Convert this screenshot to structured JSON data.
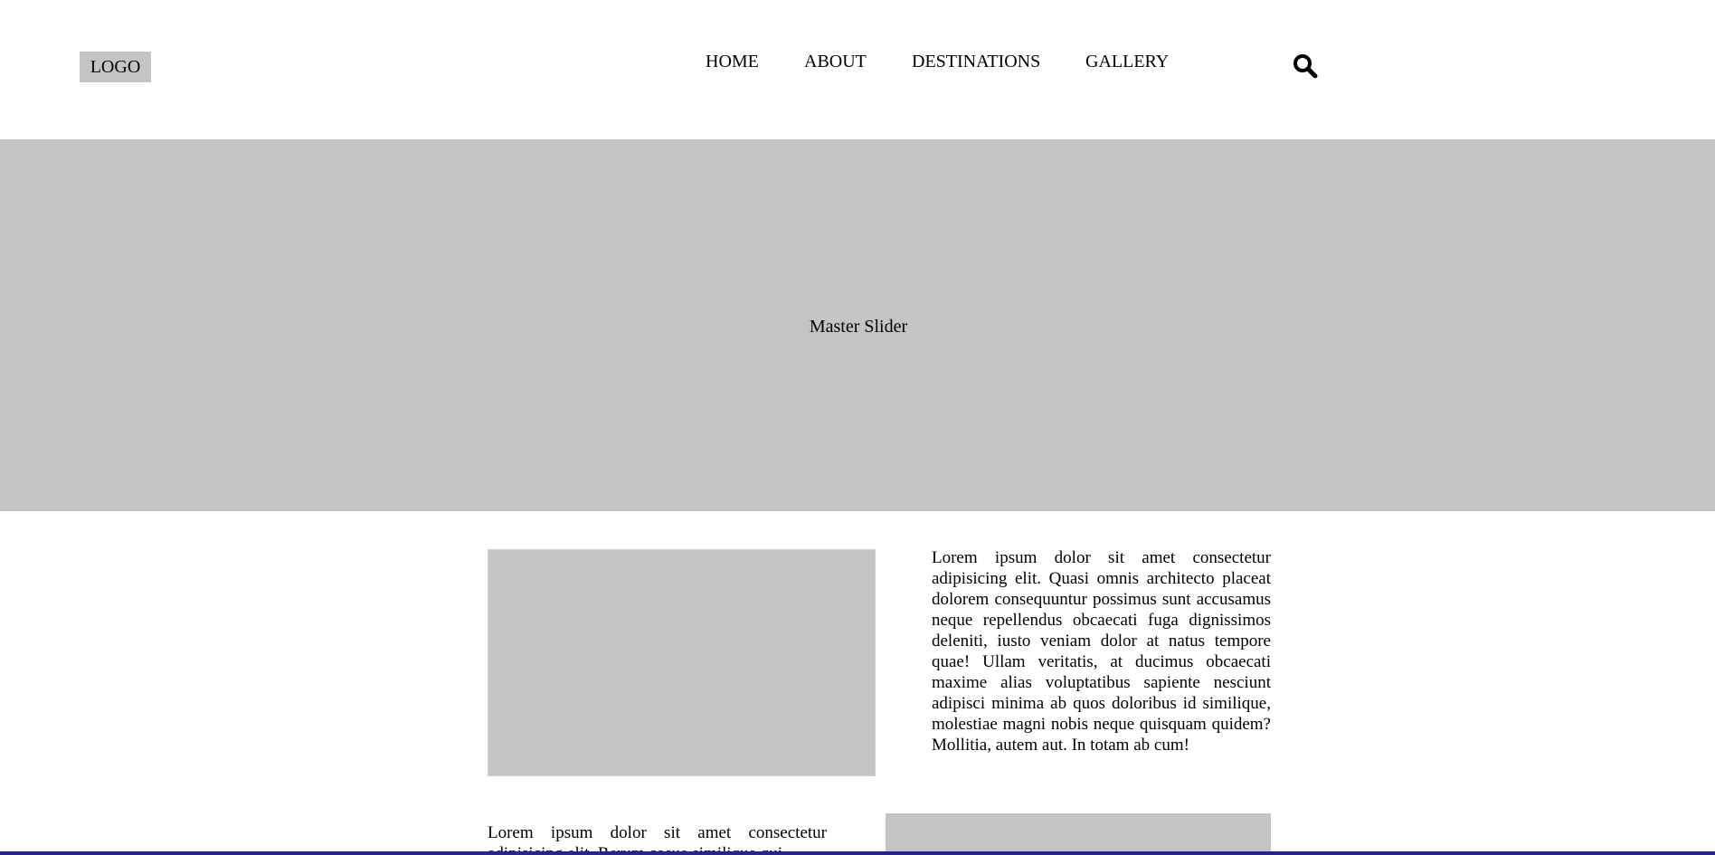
{
  "header": {
    "logo": "LOGO",
    "nav": {
      "home": "HOME",
      "about": "ABOUT",
      "destinations": "DESTINATIONS",
      "gallery": "GALLERY"
    },
    "search_icon": "search-icon"
  },
  "slider": {
    "label": "Master Slider"
  },
  "content": {
    "paragraph_1": "Lorem ipsum dolor sit amet consectetur adipisicing elit. Quasi omnis architecto placeat dolorem consequuntur possimus sunt accusamus neque repellendus obcaecati fuga dignissimos deleniti, iusto veniam dolor at natus tempore quae! Ullam veritatis, at ducimus obcaecati maxime alias voluptatibus sapiente nesciunt adipisci minima ab quos doloribus id similique, molestiae magni nobis neque quisquam quidem? Mollitia, autem aut. In totam ab cum!",
    "paragraph_2": "Lorem ipsum dolor sit amet consectetur adipisicing elit. Rerum cosue similique qui"
  },
  "colors": {
    "placeholder": "#c4c4c4",
    "bottom_bar": "#25258a"
  }
}
